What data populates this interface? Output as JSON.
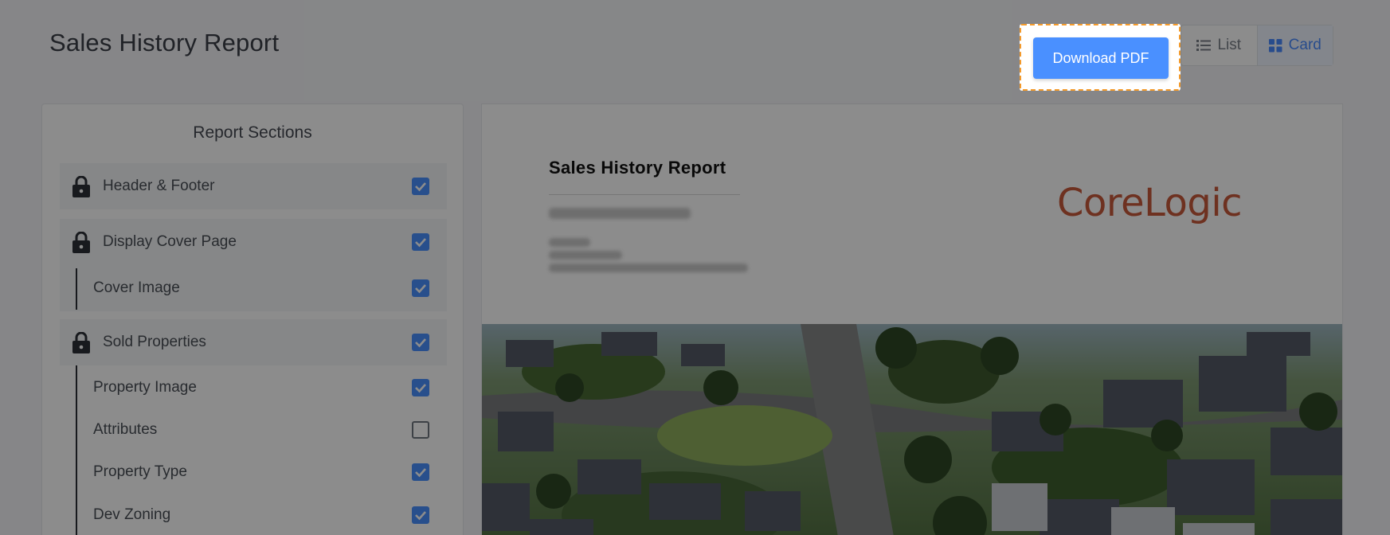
{
  "page": {
    "title": "Sales History Report"
  },
  "toolbar": {
    "download_label": "Download PDF",
    "view_list_label": "List",
    "view_card_label": "Card",
    "active_view": "Card"
  },
  "sections": {
    "title": "Report Sections",
    "items": [
      {
        "label": "Header & Footer",
        "locked": true,
        "checked": true
      },
      {
        "label": "Display Cover Page",
        "locked": true,
        "checked": true
      },
      {
        "label": "Cover Image",
        "locked": false,
        "checked": true
      },
      {
        "label": "Sold Properties",
        "locked": true,
        "checked": true
      },
      {
        "label": "Property Image",
        "locked": false,
        "checked": true
      },
      {
        "label": "Attributes",
        "locked": false,
        "checked": false
      },
      {
        "label": "Property Type",
        "locked": false,
        "checked": true
      },
      {
        "label": "Dev Zoning",
        "locked": false,
        "checked": true
      }
    ]
  },
  "preview": {
    "report_title": "Sales History Report",
    "logo_text": "CoreLogic"
  },
  "colors": {
    "accent": "#4a90ff",
    "highlight_border": "#f39a2b",
    "logo": "#c85a3b"
  }
}
